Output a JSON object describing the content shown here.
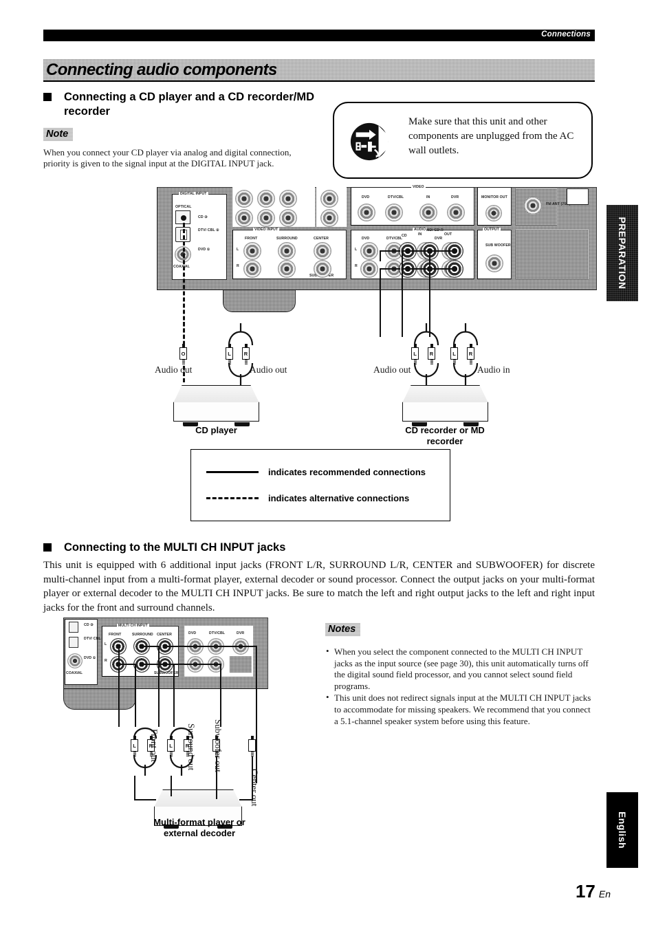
{
  "header": {
    "running_head": "Connections"
  },
  "section": {
    "band_title": "Connecting audio components"
  },
  "sub1": {
    "heading": "Connecting a CD player and a CD recorder/MD recorder",
    "note_tag": "Note",
    "note_body": "When you connect your CD player via analog and digital connection, priority is given to the signal input at the DIGITAL INPUT jack."
  },
  "warning": {
    "icon": "unplug-power-cord-icon",
    "text": "Make sure that this unit and other components are unplugged from the AC wall outlets."
  },
  "diagram1": {
    "panel_labels": {
      "digital_input": "DIGITAL INPUT",
      "optical": "OPTICAL",
      "coaxial": "COAXIAL",
      "cd": "CD ③",
      "dtv_cbl": "DTV/ CBL ②",
      "dvd": "DVD ①",
      "video_input": "VIDEO INPUT",
      "front": "FRONT",
      "surround": "SURROUND",
      "center": "CENTER",
      "subwoofer": "SUBWOOFER",
      "video": "VIDEO",
      "audio": "AUDIO",
      "dvd2": "DVD",
      "dtv_cbl2": "DTV/CBL",
      "dvr": "DVR",
      "in": "IN",
      "out": "OUT",
      "cd2": "CD",
      "md_cdr": "MD/ CD-R",
      "in_play": "IN (PLAY)",
      "out_rec": "OUT (REC)",
      "monitor_out": "MONITOR OUT",
      "output": "OUTPUT",
      "sub_woofer": "SUB WOOFER",
      "l": "L",
      "r": "R"
    },
    "cable_labels": {
      "audio_out": "Audio out",
      "audio_in": "Audio in",
      "optical": "O",
      "left": "L",
      "right": "R"
    },
    "devices": [
      {
        "name": "CD player",
        "left_label": "Audio out",
        "right_label": "Audio out"
      },
      {
        "name": "CD recorder or MD recorder",
        "left_label": "Audio out",
        "right_label": "Audio in"
      }
    ]
  },
  "legend": {
    "recommended": "indicates recommended connections",
    "alternative": "indicates alternative connections"
  },
  "sub2": {
    "heading": "Connecting to the MULTI CH INPUT jacks",
    "body": "This unit is equipped with 6 additional input jacks (FRONT L/R, SURROUND L/R, CENTER and SUBWOOFER) for discrete multi-channel input from a multi-format player, external decoder or sound processor. Connect the output jacks on your multi-format player or external decoder to the MULTI CH INPUT jacks. Be sure to match the left and right output jacks to the left and right input jacks for the front and surround channels.",
    "notes_tag": "Notes",
    "notes": [
      "When you select the component connected to the MULTI CH INPUT jacks as the input source (see page 30), this unit automatically turns off the digital sound field processor, and you cannot select sound field programs.",
      "This unit does not redirect signals input at the MULTI CH INPUT jacks to accommodate for missing speakers. We recommend that you connect a 5.1-channel speaker system before using this feature."
    ]
  },
  "diagram2": {
    "panel_labels": {
      "multi_ch_input": "MULTI CH INPUT",
      "front": "FRONT",
      "surround": "SURROUND",
      "center": "CENTER",
      "subwoofer": "SUBWOOFER",
      "cd": "CD ③",
      "dtv_cbl": "DTV/ CBL ②",
      "dvd": "DVD ①",
      "coaxial": "COAXIAL",
      "dvd2": "DVD",
      "dtv_cbl2": "DTV/CBL",
      "dvr": "DVR",
      "l": "L",
      "r": "R"
    },
    "cable_labels": {
      "front_out": "Front out",
      "surround_out": "Surround out",
      "subwoofer_out": "Subwoofer out",
      "center_out": "Center out",
      "left": "L",
      "right": "R"
    },
    "device": {
      "name_line1": "Multi-format player or",
      "name_line2": "external decoder"
    }
  },
  "side_tabs": {
    "preparation": "PREPARATION",
    "english": "English"
  },
  "footer": {
    "page_number": "17",
    "page_lang": "En"
  }
}
